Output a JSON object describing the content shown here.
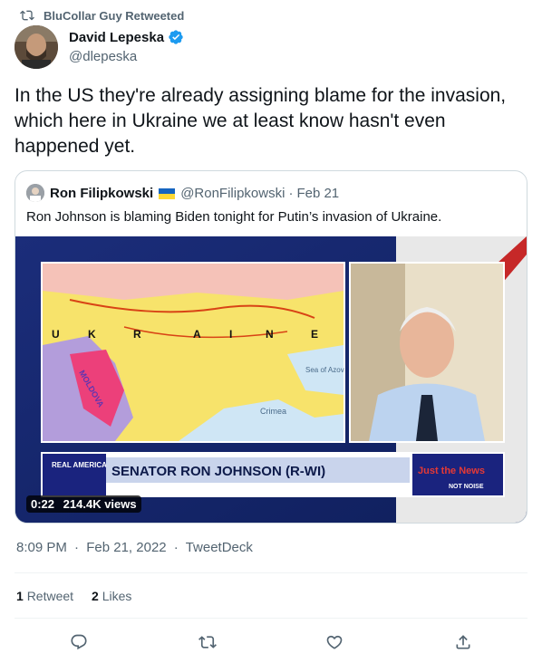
{
  "retweet_bar": {
    "label": "BluCollar Guy Retweeted",
    "icon": "retweet-icon"
  },
  "author": {
    "name": "David Lepeska",
    "handle": "@dlepeska",
    "verified": true
  },
  "tweet": {
    "text": "In the US they're already assigning blame for the invasion, which here in Ukraine we at least know hasn't even happened yet."
  },
  "quoted_tweet": {
    "name": "Ron Filipkowski",
    "handle": "@RonFilipkowski",
    "separator": "·",
    "date": "Feb 21",
    "text": "Ron Johnson is blaming Biden tonight for Putin’s invasion of Ukraine.",
    "video": {
      "duration": "0:22",
      "views": "214.4K views",
      "chyron": "SENATOR RON JOHNSON (R-WI)",
      "network_logo": "REAL AMERICA'S VOICE",
      "corner_logo": "Just the News",
      "corner_tagline": "NOT NOISE",
      "map_labels": [
        "U",
        "K",
        "R",
        "A",
        "I",
        "N",
        "E",
        "MOLDOVA",
        "Sea of Azov",
        "Crimea"
      ]
    }
  },
  "meta": {
    "time": "8:09 PM",
    "date": "Feb 21, 2022",
    "source": "TweetDeck",
    "separator": "·"
  },
  "stats": {
    "retweets_count": "1",
    "retweets_label": "Retweet",
    "likes_count": "2",
    "likes_label": "Likes"
  },
  "actions": [
    "reply-icon",
    "retweet-icon",
    "like-icon",
    "share-icon"
  ],
  "colors": {
    "verified": "#1d9bf0",
    "secondary_text": "#536471",
    "border": "#cfd9de"
  }
}
